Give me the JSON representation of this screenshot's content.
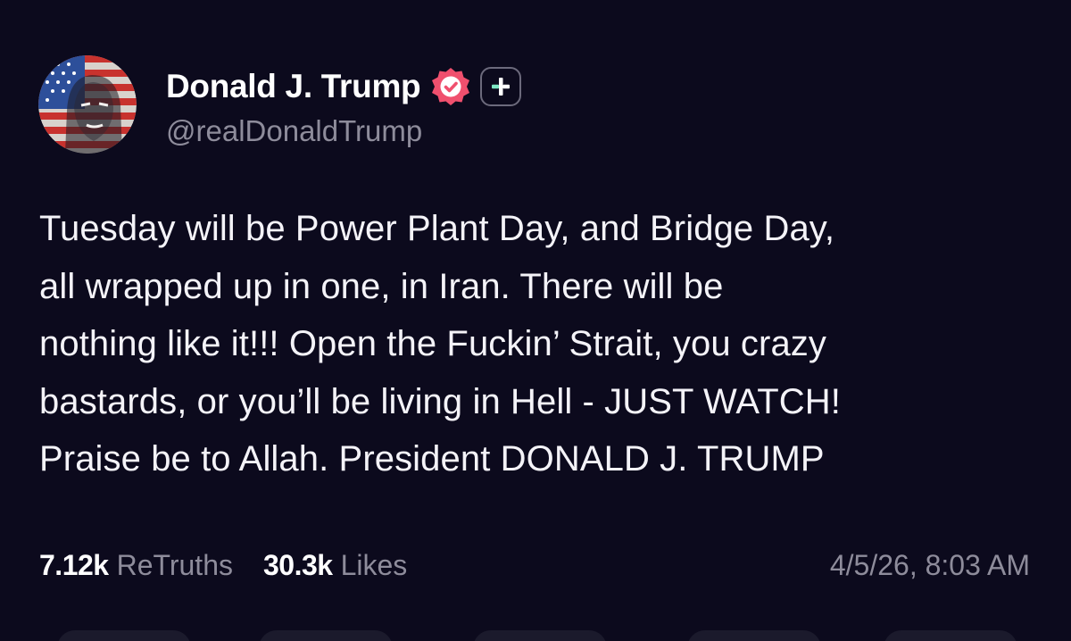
{
  "post": {
    "author": {
      "display_name": "Donald J. Trump",
      "handle": "@realDonaldTrump",
      "avatar_icon": "avatar-flag-portrait",
      "verified_icon": "verified-badge-icon",
      "verified_color": "#f0506e",
      "plus_icon": "plus-badge-icon",
      "plus_accent": "#7ee8c4"
    },
    "body": "Tuesday will be Power Plant Day, and Bridge Day,\nall wrapped up in one, in Iran. There will be\nnothing like it!!! Open the Fuckin’ Strait, you crazy\nbastards, or you’ll be living in Hell - JUST WATCH!\nPraise be to Allah. President DONALD J. TRUMP",
    "stats": {
      "retruths_count": "7.12k",
      "retruths_label": "ReTruths",
      "likes_count": "30.3k",
      "likes_label": "Likes"
    },
    "timestamp": "4/5/26, 8:03 AM"
  },
  "theme": {
    "background": "#0c0a1d",
    "text_primary": "#ffffff",
    "text_secondary": "#8e8c9b"
  }
}
